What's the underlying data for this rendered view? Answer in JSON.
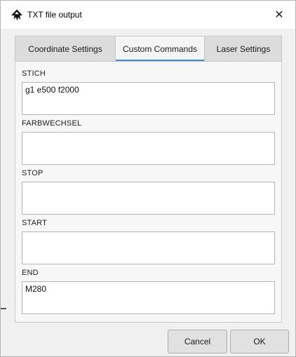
{
  "window": {
    "title": "TXT file output"
  },
  "icons": {
    "app": "inkscape-logo-icon",
    "close": "close-icon"
  },
  "tabs": [
    {
      "label": "Coordinate Settings",
      "active": false
    },
    {
      "label": "Custom Commands",
      "active": true
    },
    {
      "label": "Laser Settings",
      "active": false
    }
  ],
  "fields": [
    {
      "label": "STICH",
      "value": "g1 e500 f2000"
    },
    {
      "label": "FARBWECHSEL",
      "value": ""
    },
    {
      "label": "STOP",
      "value": ""
    },
    {
      "label": "START",
      "value": ""
    },
    {
      "label": "END",
      "value": "M280"
    }
  ],
  "buttons": {
    "cancel": "Cancel",
    "ok": "OK"
  },
  "colors": {
    "accent": "#3c8ad8"
  }
}
